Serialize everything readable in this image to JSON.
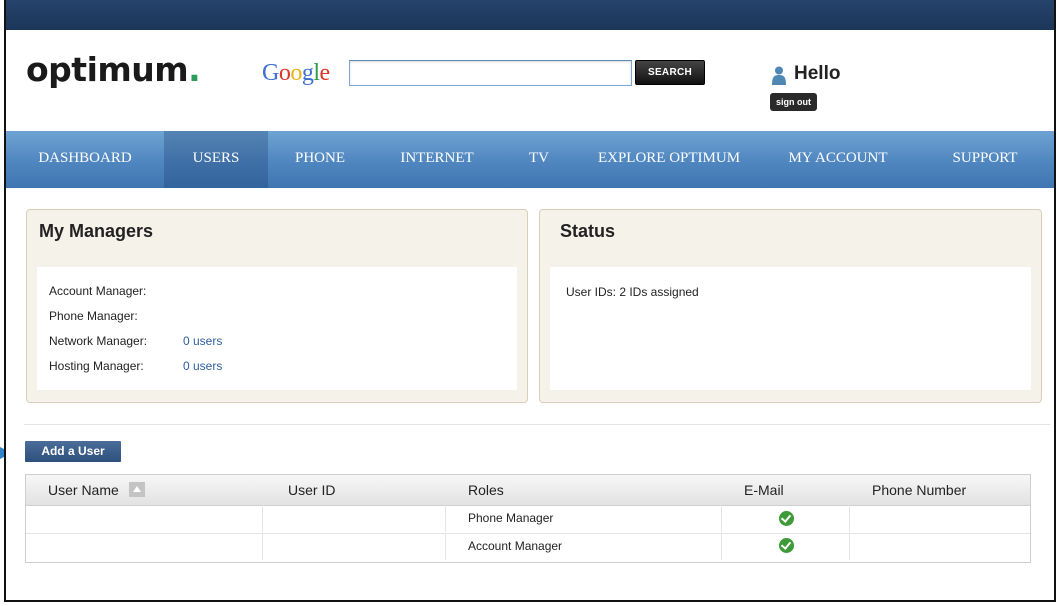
{
  "header": {
    "logo_text": "optimum",
    "logo_dot": ".",
    "search": {
      "brand": "Google",
      "value": "",
      "button_label": "SEARCH"
    },
    "greeting": "Hello",
    "sign_out_label": "sign out"
  },
  "nav": {
    "items": [
      {
        "label": "DASHBOARD"
      },
      {
        "label": "USERS"
      },
      {
        "label": "PHONE"
      },
      {
        "label": "INTERNET"
      },
      {
        "label": "TV"
      },
      {
        "label": "EXPLORE OPTIMUM"
      },
      {
        "label": "MY ACCOUNT"
      },
      {
        "label": "SUPPORT"
      }
    ],
    "active": "USERS"
  },
  "managers": {
    "title": "My Managers",
    "rows": [
      {
        "label": "Account Manager:",
        "value": ""
      },
      {
        "label": "Phone Manager:",
        "value": ""
      },
      {
        "label": "Network Manager:",
        "value": "0 users"
      },
      {
        "label": "Hosting Manager:",
        "value": "0 users"
      }
    ]
  },
  "status": {
    "title": "Status",
    "text": "User IDs: 2 IDs assigned"
  },
  "users": {
    "add_button_label": "Add a User",
    "columns": [
      "User Name",
      "User ID",
      "Roles",
      "E-Mail",
      "Phone Number"
    ],
    "rows": [
      {
        "user_name": "",
        "user_id": "",
        "role": "Phone Manager",
        "email_verified": true,
        "phone": ""
      },
      {
        "user_name": "",
        "user_id": "",
        "role": "Account Manager",
        "email_verified": true,
        "phone": ""
      }
    ]
  },
  "colors": {
    "top_strip": "#1b3658",
    "nav_blue": "#4f86bf",
    "logo_dot_green": "#2d9c5b",
    "check_green": "#3f9a3a",
    "link_blue": "#2e5fa3",
    "panel_bg": "#f5f2ea"
  }
}
